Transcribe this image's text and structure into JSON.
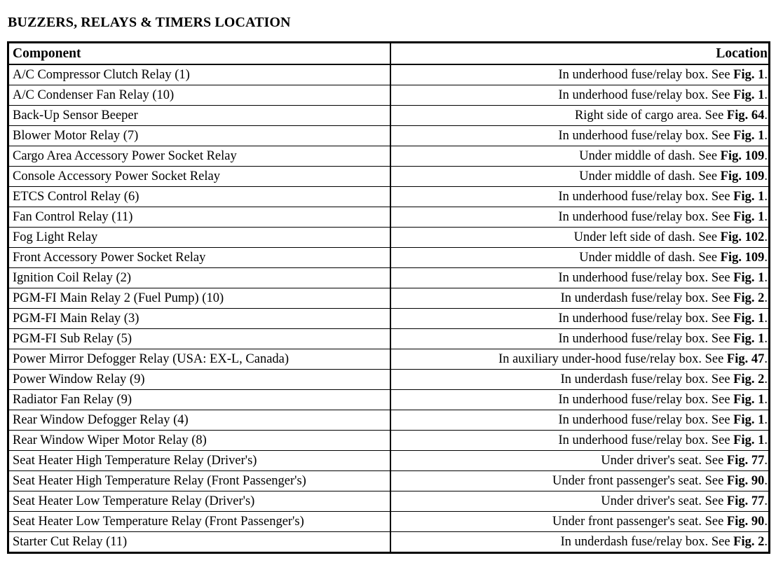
{
  "document": {
    "title": "BUZZERS, RELAYS & TIMERS LOCATION"
  },
  "table": {
    "headers": {
      "component": "Component",
      "location": "Location"
    },
    "rows": [
      {
        "component": "A/C Compressor Clutch Relay (1)",
        "location": "In underhood fuse/relay box. See Fig. 1.",
        "location_text": "In underhood fuse/relay box. See ",
        "location_fig": "Fig. 1",
        "location_end": "."
      },
      {
        "component": "A/C Condenser Fan Relay (10)",
        "location": "In underhood fuse/relay box. See Fig. 1.",
        "location_text": "In underhood fuse/relay box. See ",
        "location_fig": "Fig. 1",
        "location_end": "."
      },
      {
        "component": "Back-Up Sensor Beeper",
        "location": "Right side of cargo area. See Fig. 64.",
        "location_text": "Right side of cargo area. See ",
        "location_fig": "Fig. 64",
        "location_end": "."
      },
      {
        "component": "Blower Motor Relay (7)",
        "location": "In underhood fuse/relay box. See Fig. 1.",
        "location_text": "In underhood fuse/relay box. See ",
        "location_fig": "Fig. 1",
        "location_end": "."
      },
      {
        "component": "Cargo Area Accessory Power Socket Relay",
        "location": "Under middle of dash. See Fig. 109.",
        "location_text": "Under middle of dash. See ",
        "location_fig": "Fig. 109",
        "location_end": "."
      },
      {
        "component": "Console Accessory Power Socket Relay",
        "location": "Under middle of dash. See Fig. 109.",
        "location_text": "Under middle of dash. See ",
        "location_fig": "Fig. 109",
        "location_end": "."
      },
      {
        "component": "ETCS Control Relay (6)",
        "location": "In underhood fuse/relay box. See Fig. 1.",
        "location_text": "In underhood fuse/relay box. See ",
        "location_fig": "Fig. 1",
        "location_end": "."
      },
      {
        "component": "Fan Control Relay (11)",
        "location": "In underhood fuse/relay box. See Fig. 1.",
        "location_text": "In underhood fuse/relay box. See ",
        "location_fig": "Fig. 1",
        "location_end": "."
      },
      {
        "component": "Fog Light Relay",
        "location": "Under left side of dash. See Fig. 102.",
        "location_text": "Under left side of dash. See ",
        "location_fig": "Fig. 102",
        "location_end": "."
      },
      {
        "component": "Front Accessory Power Socket Relay",
        "location": "Under middle of dash. See Fig. 109.",
        "location_text": "Under middle of dash. See ",
        "location_fig": "Fig. 109",
        "location_end": "."
      },
      {
        "component": "Ignition Coil Relay (2)",
        "location": "In underhood fuse/relay box. See Fig. 1.",
        "location_text": "In underhood fuse/relay box. See ",
        "location_fig": "Fig. 1",
        "location_end": "."
      },
      {
        "component": "PGM-FI Main Relay 2 (Fuel Pump) (10)",
        "location": "In underdash fuse/relay box. See Fig. 2.",
        "location_text": "In underdash fuse/relay box. See ",
        "location_fig": "Fig. 2",
        "location_end": "."
      },
      {
        "component": "PGM-FI Main Relay (3)",
        "location": "In underhood fuse/relay box. See Fig. 1.",
        "location_text": "In underhood fuse/relay box. See ",
        "location_fig": "Fig. 1",
        "location_end": "."
      },
      {
        "component": "PGM-FI Sub Relay (5)",
        "location": "In underhood fuse/relay box. See Fig. 1.",
        "location_text": "In underhood fuse/relay box. See ",
        "location_fig": "Fig. 1",
        "location_end": "."
      },
      {
        "component": "Power Mirror Defogger Relay (USA: EX-L, Canada)",
        "location": "In auxiliary under-hood fuse/relay box. See Fig. 47.",
        "location_text": "In auxiliary under-hood fuse/relay box. See ",
        "location_fig": "Fig. 47",
        "location_end": "."
      },
      {
        "component": "Power Window Relay (9)",
        "location": "In underdash fuse/relay box. See Fig. 2.",
        "location_text": "In underdash fuse/relay box. See ",
        "location_fig": "Fig. 2",
        "location_end": "."
      },
      {
        "component": "Radiator Fan Relay (9)",
        "location": "In underhood fuse/relay box. See Fig. 1.",
        "location_text": "In underhood fuse/relay box. See ",
        "location_fig": "Fig. 1",
        "location_end": "."
      },
      {
        "component": "Rear Window Defogger Relay (4)",
        "location": "In underhood fuse/relay box. See Fig. 1.",
        "location_text": "In underhood fuse/relay box. See ",
        "location_fig": "Fig. 1",
        "location_end": "."
      },
      {
        "component": "Rear Window Wiper Motor Relay (8)",
        "location": "In underhood fuse/relay box. See Fig. 1.",
        "location_text": "In underhood fuse/relay box. See ",
        "location_fig": "Fig. 1",
        "location_end": "."
      },
      {
        "component": "Seat Heater High Temperature Relay (Driver's)",
        "location": "Under driver's seat. See Fig. 77.",
        "location_text": "Under driver's seat. See ",
        "location_fig": "Fig. 77",
        "location_end": "."
      },
      {
        "component": "Seat Heater High Temperature Relay (Front Passenger's)",
        "location": "Under front passenger's seat. See Fig. 90.",
        "location_text": "Under front passenger's seat. See ",
        "location_fig": "Fig. 90",
        "location_end": "."
      },
      {
        "component": "Seat Heater Low Temperature Relay (Driver's)",
        "location": "Under driver's seat. See Fig. 77.",
        "location_text": "Under driver's seat. See ",
        "location_fig": "Fig. 77",
        "location_end": "."
      },
      {
        "component": "Seat Heater Low Temperature Relay (Front Passenger's)",
        "location": "Under front passenger's seat. See Fig. 90.",
        "location_text": "Under front passenger's seat. See ",
        "location_fig": "Fig. 90",
        "location_end": "."
      },
      {
        "component": "Starter Cut Relay (11)",
        "location": "In underdash fuse/relay box. See Fig. 2.",
        "location_text": "In underdash fuse/relay box. See ",
        "location_fig": "Fig. 2",
        "location_end": "."
      }
    ]
  }
}
